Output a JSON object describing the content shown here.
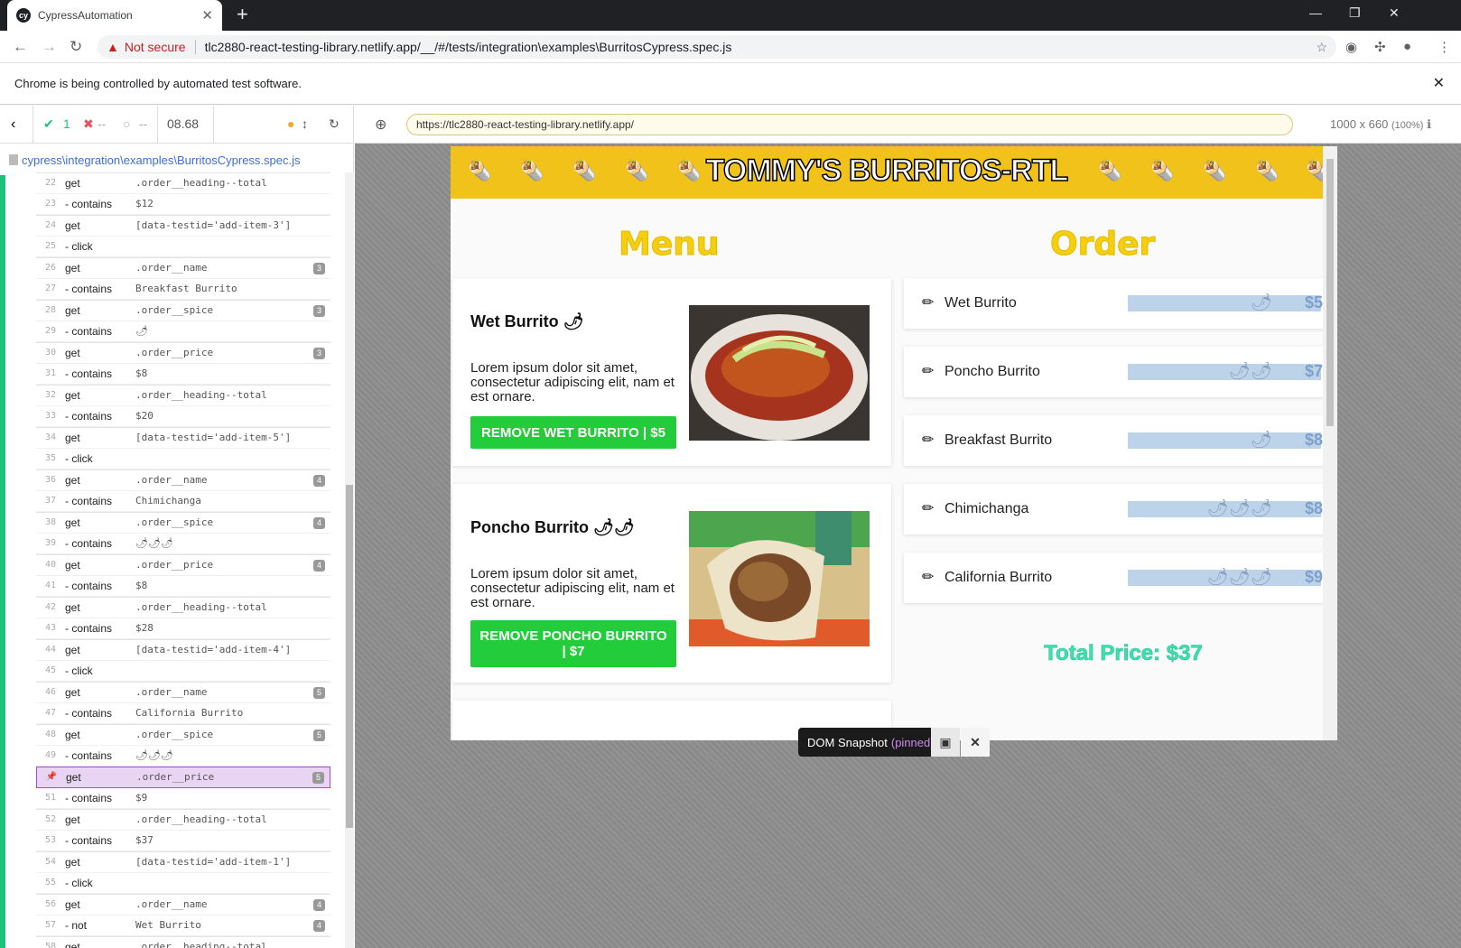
{
  "browser": {
    "tab_title": "CypressAutomation",
    "tab_favicon": "cy",
    "warning_text": "Not secure",
    "url": "tlc2880-react-testing-library.netlify.app/__/#/tests/integration\\examples\\BurritosCypress.spec.js",
    "infobar_text": "Chrome is being controlled by automated test software."
  },
  "runner": {
    "passed": "1",
    "failed": "--",
    "pending": "--",
    "duration": "08.68",
    "spec_path": "cypress\\integration\\examples\\BurritosCypress.spec.js",
    "commands": [
      {
        "ln": "22",
        "name": "get",
        "msg": ".order__heading--total",
        "badge": ""
      },
      {
        "ln": "23",
        "name": "- contains",
        "msg": "$12",
        "badge": ""
      },
      {
        "ln": "24",
        "name": "get",
        "msg": "[data-testid='add-item-3']",
        "badge": ""
      },
      {
        "ln": "25",
        "name": "- click",
        "msg": "",
        "badge": ""
      },
      {
        "ln": "26",
        "name": "get",
        "msg": ".order__name",
        "badge": "3"
      },
      {
        "ln": "27",
        "name": "- contains",
        "msg": "Breakfast Burrito",
        "badge": ""
      },
      {
        "ln": "28",
        "name": "get",
        "msg": ".order__spice",
        "badge": "3"
      },
      {
        "ln": "29",
        "name": "- contains",
        "msg": "🌶",
        "badge": ""
      },
      {
        "ln": "30",
        "name": "get",
        "msg": ".order__price",
        "badge": "3"
      },
      {
        "ln": "31",
        "name": "- contains",
        "msg": "$8",
        "badge": ""
      },
      {
        "ln": "32",
        "name": "get",
        "msg": ".order__heading--total",
        "badge": ""
      },
      {
        "ln": "33",
        "name": "- contains",
        "msg": "$20",
        "badge": ""
      },
      {
        "ln": "34",
        "name": "get",
        "msg": "[data-testid='add-item-5']",
        "badge": ""
      },
      {
        "ln": "35",
        "name": "- click",
        "msg": "",
        "badge": ""
      },
      {
        "ln": "36",
        "name": "get",
        "msg": ".order__name",
        "badge": "4"
      },
      {
        "ln": "37",
        "name": "- contains",
        "msg": "Chimichanga",
        "badge": ""
      },
      {
        "ln": "38",
        "name": "get",
        "msg": ".order__spice",
        "badge": "4"
      },
      {
        "ln": "39",
        "name": "- contains",
        "msg": "🌶🌶🌶",
        "badge": ""
      },
      {
        "ln": "40",
        "name": "get",
        "msg": ".order__price",
        "badge": "4"
      },
      {
        "ln": "41",
        "name": "- contains",
        "msg": "$8",
        "badge": ""
      },
      {
        "ln": "42",
        "name": "get",
        "msg": ".order__heading--total",
        "badge": ""
      },
      {
        "ln": "43",
        "name": "- contains",
        "msg": "$28",
        "badge": ""
      },
      {
        "ln": "44",
        "name": "get",
        "msg": "[data-testid='add-item-4']",
        "badge": ""
      },
      {
        "ln": "45",
        "name": "- click",
        "msg": "",
        "badge": ""
      },
      {
        "ln": "46",
        "name": "get",
        "msg": ".order__name",
        "badge": "5"
      },
      {
        "ln": "47",
        "name": "- contains",
        "msg": "California Burrito",
        "badge": ""
      },
      {
        "ln": "48",
        "name": "get",
        "msg": ".order__spice",
        "badge": "5"
      },
      {
        "ln": "49",
        "name": "- contains",
        "msg": "🌶🌶🌶",
        "badge": ""
      },
      {
        "ln": "📌",
        "name": "get",
        "msg": ".order__price",
        "badge": "5",
        "pinned": true
      },
      {
        "ln": "51",
        "name": "- contains",
        "msg": "$9",
        "badge": ""
      },
      {
        "ln": "52",
        "name": "get",
        "msg": ".order__heading--total",
        "badge": ""
      },
      {
        "ln": "53",
        "name": "- contains",
        "msg": "$37",
        "badge": ""
      },
      {
        "ln": "54",
        "name": "get",
        "msg": "[data-testid='add-item-1']",
        "badge": ""
      },
      {
        "ln": "55",
        "name": "- click",
        "msg": "",
        "badge": ""
      },
      {
        "ln": "56",
        "name": "get",
        "msg": ".order__name",
        "badge": "4"
      },
      {
        "ln": "57",
        "name": "- not",
        "msg": "Wet Burrito",
        "badge": "4"
      },
      {
        "ln": "58",
        "name": "get",
        "msg": ".order__heading--total",
        "badge": ""
      }
    ]
  },
  "preview": {
    "url": "https://tlc2880-react-testing-library.netlify.app/",
    "viewport": "1000 x 660",
    "zoom": "(100%)",
    "snapshot_label": "DOM Snapshot",
    "snapshot_state": "(pinned)"
  },
  "app": {
    "header": "TOMMY'S BURRITOS-RTL",
    "menu_title": "Menu",
    "order_title": "Order",
    "menu_items": [
      {
        "name": "Wet Burrito",
        "spice": "🌶",
        "desc": "Lorem ipsum dolor sit amet, consectetur adipiscing elit, nam et est ornare.",
        "button": "REMOVE WET BURRITO | $5"
      },
      {
        "name": "Poncho Burrito",
        "spice": "🌶🌶",
        "desc": "Lorem ipsum dolor sit amet, consectetur adipiscing elit, nam et est ornare.",
        "button": "REMOVE PONCHO BURRITO | $7"
      }
    ],
    "order_items": [
      {
        "name": "Wet Burrito",
        "spice": "🌶",
        "price": "$5"
      },
      {
        "name": "Poncho Burrito",
        "spice": "🌶🌶",
        "price": "$7"
      },
      {
        "name": "Breakfast Burrito",
        "spice": "🌶",
        "price": "$8"
      },
      {
        "name": "Chimichanga",
        "spice": "🌶🌶🌶",
        "price": "$8"
      },
      {
        "name": "California Burrito",
        "spice": "🌶🌶🌶",
        "price": "$9"
      }
    ],
    "total": "Total Price: $37"
  }
}
